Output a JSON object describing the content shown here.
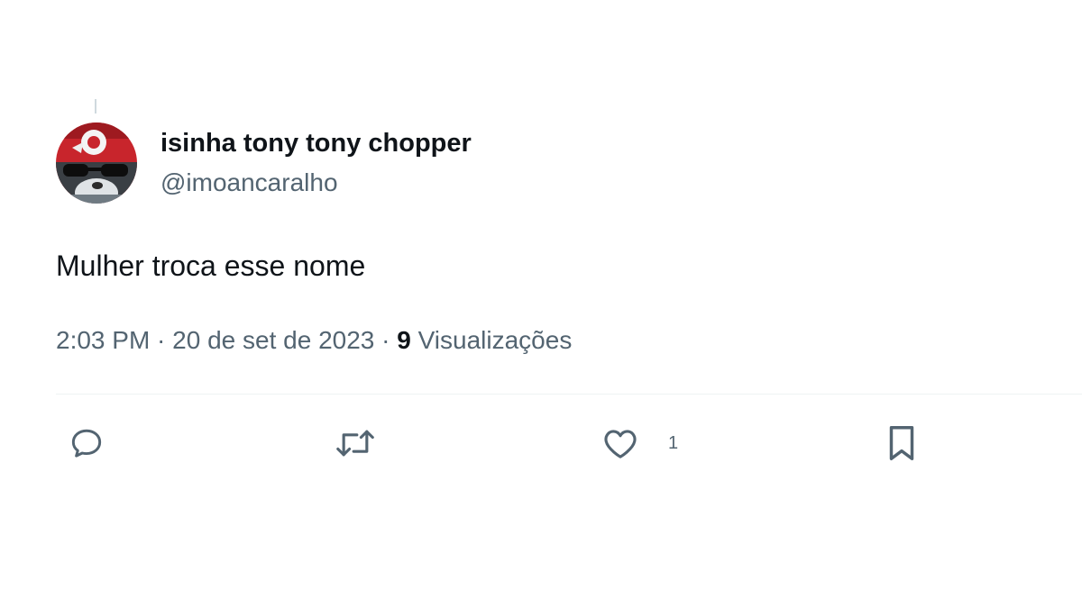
{
  "tweet": {
    "author": {
      "display_name": "isinha tony tony chopper",
      "handle": "@imoancaralho"
    },
    "text": "Mulher troca esse nome",
    "meta": {
      "time": "2:03 PM",
      "separator": " · ",
      "date": "20 de set de 2023",
      "views_count": "9",
      "views_label": " Visualizações"
    },
    "actions": {
      "reply_icon": "reply-icon",
      "retweet_icon": "retweet-icon",
      "like_icon": "heart-icon",
      "like_count": "1",
      "bookmark_icon": "bookmark-icon"
    },
    "colors": {
      "primary_text": "#0f1419",
      "secondary_text": "#536471",
      "divider": "#eff3f4"
    }
  }
}
